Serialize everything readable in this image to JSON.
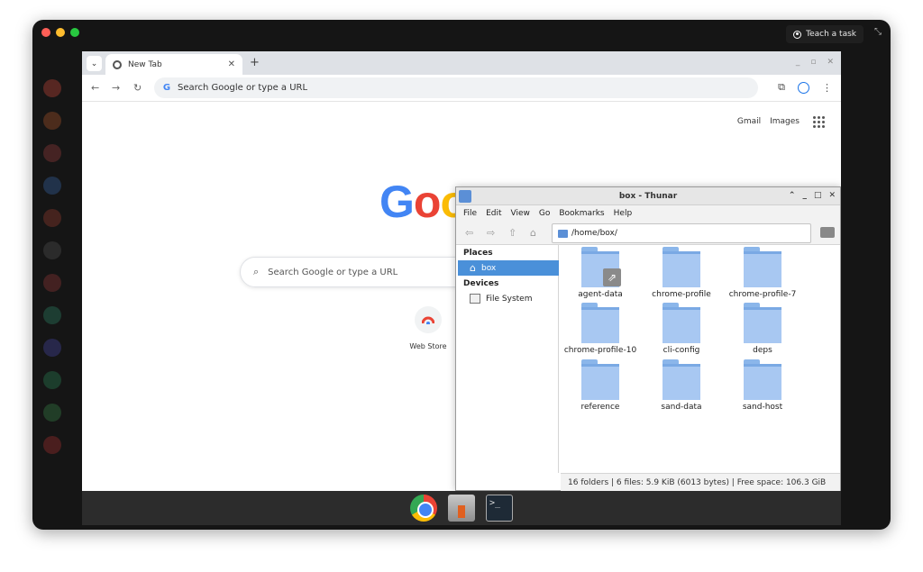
{
  "recorder": {
    "teach_label": "Teach a task"
  },
  "chrome": {
    "tab_title": "New Tab",
    "omnibox_placeholder": "Search Google or type a URL",
    "top_links": [
      "Gmail",
      "Images"
    ],
    "logo_text": "Goo",
    "search_placeholder": "Search Google or type a URL",
    "shortcut_label": "Web Store"
  },
  "thunar": {
    "title": "box - Thunar",
    "menu": [
      "File",
      "Edit",
      "View",
      "Go",
      "Bookmarks",
      "Help"
    ],
    "path": "/home/box/",
    "sidebar": {
      "places_heading": "Places",
      "places": [
        "box"
      ],
      "devices_heading": "Devices",
      "devices": [
        "File System"
      ]
    },
    "folders": [
      "agent-data",
      "chrome-profile",
      "chrome-profile-7",
      "chrome-profile-10",
      "cli-config",
      "deps",
      "reference",
      "sand-data",
      "sand-host"
    ],
    "status": "16 folders  |  6 files: 5.9 KiB (6013 bytes)  |  Free space: 106.3 GiB"
  },
  "colors": {
    "selection": "#4a90d9",
    "folder": "#a8c8f2",
    "google_blue": "#4285f4",
    "google_red": "#ea4335"
  }
}
